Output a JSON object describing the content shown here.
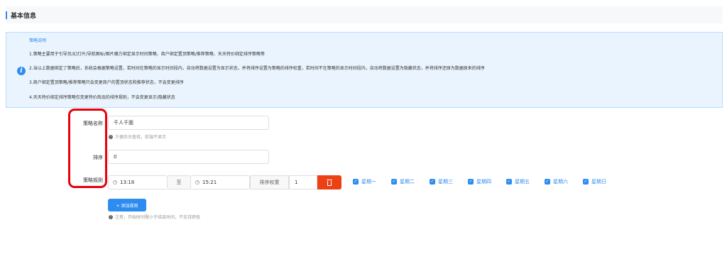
{
  "section": {
    "title": "基本信息"
  },
  "notice": {
    "title": "策略说明",
    "lines": [
      "1.策略主要用于引导页/幻灯片/导航图标/图片魔方绑定显示时间策略、商户绑定置顶策略/推荐策略、天天特价绑定排序策略等",
      "2.当以上数据绑定了策略后，系统会根据策略设置，若时间在策略的显示时间段内，自动将数据设置为显示状态，并将排序设置为策略的排序权重，若时间不在策略的显示时间段内，自动将数据设置为隐藏状态，并将排序还原为数据原来的排序",
      "3.商户绑定置顶策略/推荐策略只会变更商户的置顶状态和推荐状态，不会变更排序",
      "4.天天特价绑定排序策略仅变更特价商品的排序规则，不会变更显示/隐藏状态"
    ]
  },
  "form": {
    "name_label": "策略名称",
    "name_value": "千人千面",
    "name_hint": "方便后台查找，前端不显示",
    "order_label": "排序",
    "order_value": "0",
    "rule_label": "策略规则",
    "rule": {
      "start_time": "13:18",
      "separator": "至",
      "end_time": "15:21",
      "weight_label": "排序权重",
      "weight_value": "1",
      "days": [
        "星期一",
        "星期二",
        "星期三",
        "星期四",
        "星期五",
        "星期六",
        "星期日"
      ]
    },
    "add_button": "+ 添加规则",
    "time_hint": "注意，开始时间需小于结束时间，不支持跨夜"
  },
  "colors": {
    "accent": "#2d8cf0",
    "danger": "#ed4014",
    "highlight": "#e8000b",
    "notice_bg": "#eaf4fe"
  },
  "icons": [
    "info-icon",
    "clock-icon",
    "trash-icon",
    "checkbox-checked-icon"
  ]
}
